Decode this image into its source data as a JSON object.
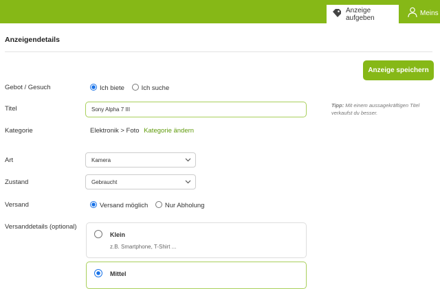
{
  "header": {
    "post_ad": "Anzeige aufgeben",
    "account": "Meins"
  },
  "page": {
    "title": "Anzeigendetails",
    "save_label": "Anzeige speichern"
  },
  "form": {
    "offer_type": {
      "label": "Gebot / Gesuch",
      "options": [
        "Ich biete",
        "Ich suche"
      ],
      "selected": "Ich biete"
    },
    "title": {
      "label": "Titel",
      "value": "Sony Alpha 7 III"
    },
    "tip": {
      "prefix": "Tipp:",
      "text": "Mit einem aussagekräftigen Titel verkaufst du besser."
    },
    "category": {
      "label": "Kategorie",
      "value": "Elektronik > Foto",
      "change": "Kategorie ändern"
    },
    "type": {
      "label": "Art",
      "value": "Kamera"
    },
    "condition": {
      "label": "Zustand",
      "value": "Gebraucht"
    },
    "shipping": {
      "label": "Versand",
      "options": [
        "Versand möglich",
        "Nur Abholung"
      ],
      "selected": "Versand möglich"
    },
    "shipping_details": {
      "label": "Versanddetails (optional)",
      "options": [
        {
          "title": "Klein",
          "desc": "z.B. Smartphone, T-Shirt ..."
        },
        {
          "title": "Mittel"
        }
      ],
      "selected": "Mittel"
    }
  },
  "colors": {
    "brand": "#86b817"
  }
}
